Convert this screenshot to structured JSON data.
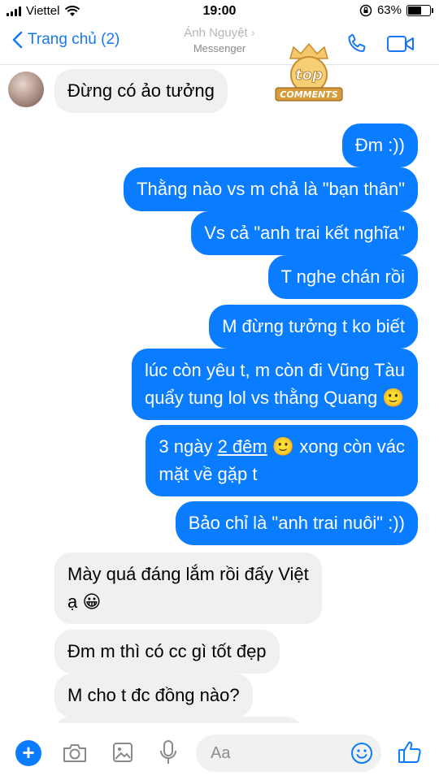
{
  "status_bar": {
    "carrier": "Viettel",
    "time": "19:00",
    "battery_percent": "63%",
    "battery_level": 0.63
  },
  "header": {
    "back_label": "Trang chủ (2)",
    "contact_name": "Ánh Nguyệt",
    "contact_subtitle": "Messenger"
  },
  "watermark": {
    "line1": "top",
    "line2": "COMMENTS"
  },
  "messages": [
    {
      "side": "in",
      "text": "Đừng có ảo tưởng"
    },
    {
      "side": "out",
      "text": "Đm :))"
    },
    {
      "side": "out",
      "text": "Thằng nào vs m chả là \"bạn thân\""
    },
    {
      "side": "out",
      "text": "Vs cả \"anh trai kết nghĩa\""
    },
    {
      "side": "out",
      "text": "T nghe chán rồi"
    },
    {
      "side": "out",
      "text": "M đừng tưởng t ko biết"
    },
    {
      "side": "out",
      "line1": "lúc còn yêu t, m còn đi Vũng Tàu",
      "line2": "quẩy tung lol vs thằng Quang 🙂"
    },
    {
      "side": "out",
      "line1_a": "3 ngày ",
      "line1_b": "2 đêm",
      "line1_c": " 🙂 xong còn vác",
      "line2": "mặt về gặp t"
    },
    {
      "side": "out",
      "text": "Bảo chỉ là \"anh trai nuôi\" :))"
    },
    {
      "side": "in",
      "line1": "Mày quá đáng lắm rồi đấy Việt",
      "line2": "ạ 😀"
    },
    {
      "side": "in",
      "text": "Đm m thì có cc gì tốt đẹp"
    },
    {
      "side": "in",
      "text": "M cho t đc đồng nào?"
    }
  ],
  "composer": {
    "placeholder": "Aa"
  },
  "colors": {
    "accent": "#0a7cff",
    "incoming_bubble": "#f0f0f0",
    "outgoing_text": "#ffffff"
  }
}
